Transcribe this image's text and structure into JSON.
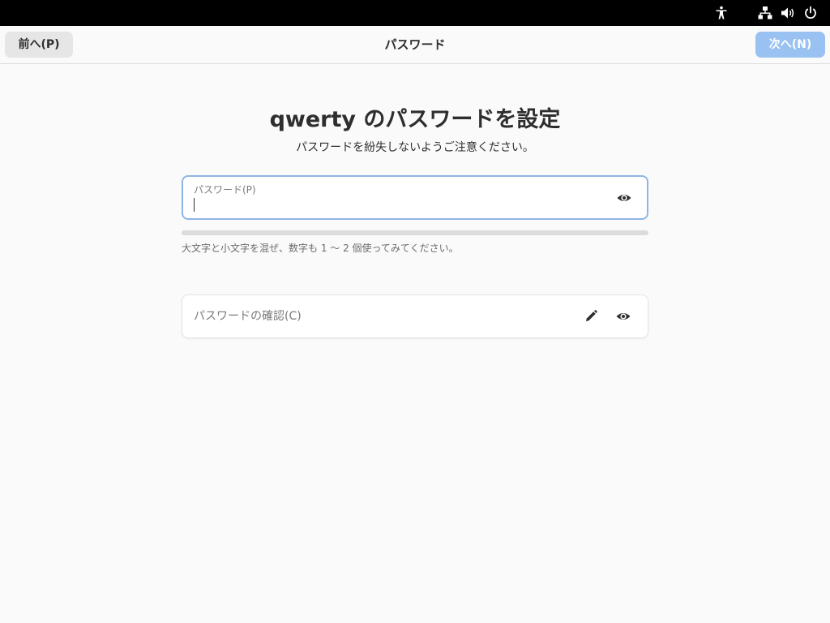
{
  "top_bar": {
    "icons": [
      "accessibility-icon",
      "network-wired-icon",
      "volume-icon",
      "power-icon"
    ]
  },
  "header_bar": {
    "prev_label": "前へ(P)",
    "title": "パスワード",
    "next_label": "次へ(N)"
  },
  "main": {
    "title": "qwerty のパスワードを設定",
    "subtitle": "パスワードを紛失しないようご注意ください。",
    "password_field": {
      "label": "パスワード(P)",
      "value": ""
    },
    "strength_hint": "大文字と小文字を混ぜ、数字も 1 〜 2 個使ってみてください。",
    "confirm_field": {
      "placeholder": "パスワードの確認(C)",
      "value": ""
    }
  },
  "colors": {
    "accent": "#3584e4",
    "next_button_disabled": "#99c1f1",
    "top_bar": "#000000",
    "background": "#fafafa"
  }
}
